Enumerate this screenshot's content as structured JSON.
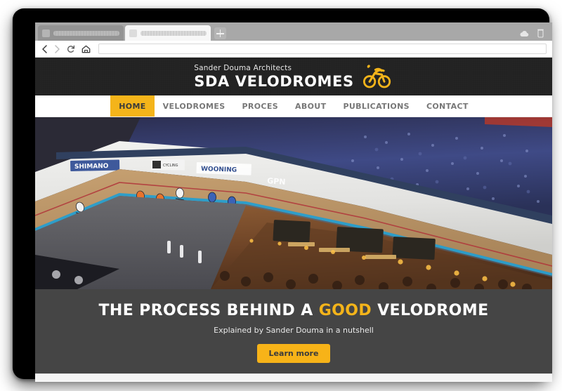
{
  "browser": {
    "tabs": [
      {
        "title": "",
        "active": false,
        "favicon": "generic-page-icon"
      },
      {
        "title": "",
        "active": true,
        "favicon": "generic-page-icon"
      }
    ],
    "new_tab_label": "+",
    "toolbar": {
      "back_icon": "chevron-left-icon",
      "forward_icon": "chevron-right-icon",
      "reload_icon": "reload-icon",
      "home_icon": "home-icon",
      "url_value": "",
      "url_placeholder": ""
    },
    "status_icons": {
      "cloud": "cloud-icon",
      "battery": "battery-icon"
    }
  },
  "site": {
    "header": {
      "brand_sub": "Sander Douma Architects",
      "brand_main": "SDA VELODROMES",
      "logo_icon": "cyclist-logo-icon",
      "logo_color": "#f4b41a",
      "background_color": "#222222"
    },
    "nav": {
      "items": [
        {
          "label": "HOME",
          "active": true
        },
        {
          "label": "VELODROMES",
          "active": false
        },
        {
          "label": "PROCES",
          "active": false
        },
        {
          "label": "ABOUT",
          "active": false
        },
        {
          "label": "PUBLICATIONS",
          "active": false
        },
        {
          "label": "CONTACT",
          "active": false
        }
      ],
      "active_color": "#f4b41a",
      "text_color": "#777777"
    },
    "hero": {
      "photo_alt": "Indoor velodrome with cyclists racing on banked wooden track and packed crowd",
      "banners": [
        "SHIMANO",
        "CYCLING HUB",
        "WOONING",
        "GPN"
      ],
      "band_color": "#454545",
      "title_prefix": "THE PROCESS BEHIND A ",
      "title_highlight": "GOOD",
      "title_suffix": " VELODROME",
      "subtitle": "Explained by Sander Douma in a nutshell",
      "cta_label": "Learn more",
      "cta_color": "#f7b318"
    }
  }
}
